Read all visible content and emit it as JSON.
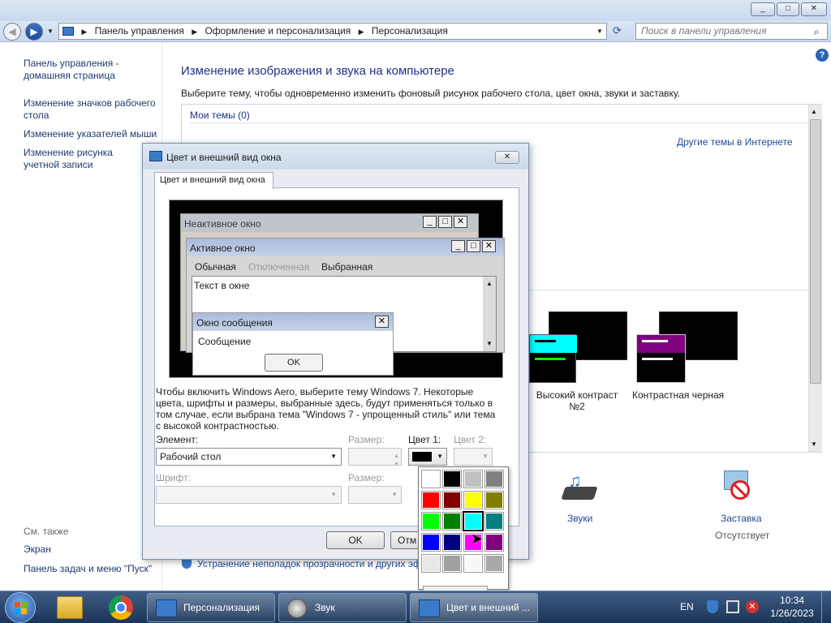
{
  "window": {
    "minimize": "_",
    "maximize": "□",
    "close": "✕"
  },
  "address": {
    "crumbs": [
      "Панель управления",
      "Оформление и персонализация",
      "Персонализация"
    ],
    "search_placeholder": "Поиск в панели управления"
  },
  "left_pane": {
    "home": "Панель управления - домашняя страница",
    "links": [
      "Изменение значков рабочего стола",
      "Изменение указателей мыши",
      "Изменение рисунка учетной записи"
    ],
    "see_also": "См. также",
    "see_also_links": [
      "Экран",
      "Панель задач и меню \"Пуск\""
    ]
  },
  "main": {
    "title": "Изменение изображения и звука на компьютере",
    "description": "Выберите тему, чтобы одновременно изменить фоновый рисунок рабочего стола, цвет окна, звуки и заставку.",
    "my_themes": "Мои темы (0)",
    "more_themes": "Другие темы в Интернете",
    "themes": [
      "Высокий контраст №2",
      "Контрастная черная"
    ],
    "sounds": "Звуки",
    "screensaver": "Заставка",
    "screensaver_value": "Отсутствует",
    "troubleshoot": "Устранение неполадок прозрачности и других эф"
  },
  "dialog": {
    "title": "Цвет и внешний вид окна",
    "tab": "Цвет и внешний вид окна",
    "inactive_window": "Неактивное окно",
    "active_window": "Активное окно",
    "menu_normal": "Обычная",
    "menu_disabled": "Отключенная",
    "menu_selected": "Выбранная",
    "window_text": "Текст в окне",
    "msgbox_title": "Окно сообщения",
    "msgbox_text": "Сообщение",
    "msgbox_ok": "OK",
    "info": "Чтобы включить Windows Aero, выберите тему Windows 7. Некоторые цвета, шрифты и размеры, выбранные здесь, будут применяться только в том случае, если выбрана тема \"Windows 7 - упрощенный стиль\" или тема с высокой контрастностью.",
    "element_label": "Элемент:",
    "element_value": "Рабочий стол",
    "size_label": "Размер:",
    "color1_label": "Цвет 1:",
    "color2_label": "Цвет 2:",
    "font_label": "Шрифт:",
    "size2_label": "Размер:",
    "ok": "OK",
    "cancel": "Отм"
  },
  "palette": {
    "colors": [
      "#ffffff",
      "#000000",
      "#c0c0c0",
      "#808080",
      "#ff0000",
      "#800000",
      "#ffff00",
      "#808000",
      "#00ff00",
      "#008000",
      "#00ffff",
      "#008080",
      "#0000ff",
      "#000080",
      "#ff00ff",
      "#800080",
      "#e8e8e8",
      "#a0a0a0",
      "#f8f8f8",
      "#a8a8a8"
    ],
    "selected_index": 10
  },
  "taskbar": {
    "items": [
      "Персонализация",
      "Звук",
      "Цвет и внешний ..."
    ],
    "lang": "EN",
    "time": "10:34",
    "date": "1/26/2023"
  }
}
